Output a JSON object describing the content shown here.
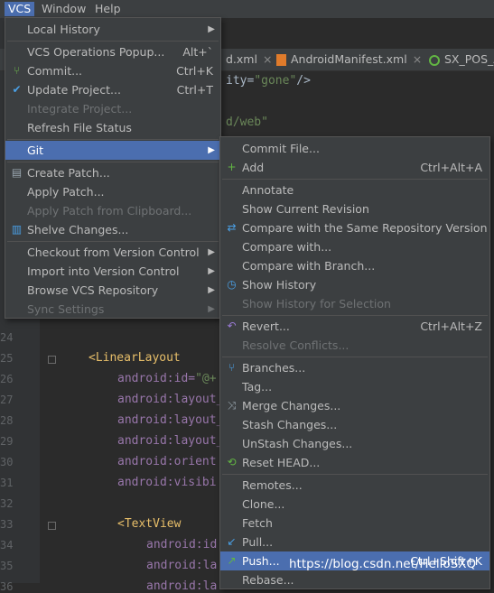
{
  "menubar": {
    "items": [
      "VCS",
      "Window",
      "Help"
    ]
  },
  "tabs": [
    {
      "label": "d.xml",
      "icon": "xml-file-icon"
    },
    {
      "label": "AndroidManifest.xml",
      "icon": "xml-file-icon"
    },
    {
      "label": "SX_POS_A",
      "icon": "android-icon"
    }
  ],
  "code": {
    "top": [
      {
        "text_pre": "ity=",
        "text_str": "\"gone\"",
        "text_post": "/>"
      },
      {
        "text_str": "d/web\""
      }
    ],
    "lines": [
      {
        "n": "24"
      },
      {
        "n": "25",
        "tag": "<LinearLayout"
      },
      {
        "n": "26",
        "attr": "android:id=",
        "str": "\"@+"
      },
      {
        "n": "27",
        "attr": "android:layout_"
      },
      {
        "n": "28",
        "attr": "android:layout_"
      },
      {
        "n": "29",
        "attr": "android:layout_"
      },
      {
        "n": "30",
        "attr": "android:orient"
      },
      {
        "n": "31",
        "attr": "android:visibi"
      },
      {
        "n": "32"
      },
      {
        "n": "33",
        "tag": "<TextView"
      },
      {
        "n": "34",
        "attr": "android:id"
      },
      {
        "n": "35",
        "attr": "android:la"
      },
      {
        "n": "36",
        "attr": "android:la"
      }
    ]
  },
  "vcs_menu": {
    "items": [
      {
        "label": "Local History",
        "submenu": true,
        "disabled": false
      },
      {
        "sep": true
      },
      {
        "label": "VCS Operations Popup...",
        "shortcut": "Alt+`",
        "disabled": false
      },
      {
        "label": "Commit...",
        "shortcut": "Ctrl+K",
        "icon": "commit-icon",
        "disabled": false
      },
      {
        "label": "Update Project...",
        "shortcut": "Ctrl+T",
        "icon": "update-icon",
        "disabled": false
      },
      {
        "label": "Integrate Project...",
        "disabled": true
      },
      {
        "label": "Refresh File Status",
        "disabled": false
      },
      {
        "sep": true
      },
      {
        "label": "Git",
        "submenu": true,
        "selected": true
      },
      {
        "sep": true
      },
      {
        "label": "Create Patch...",
        "icon": "patch-icon",
        "disabled": false
      },
      {
        "label": "Apply Patch...",
        "disabled": false
      },
      {
        "label": "Apply Patch from Clipboard...",
        "disabled": true
      },
      {
        "label": "Shelve Changes...",
        "icon": "shelve-icon",
        "disabled": false
      },
      {
        "sep": true
      },
      {
        "label": "Checkout from Version Control",
        "submenu": true,
        "disabled": false
      },
      {
        "label": "Import into Version Control",
        "submenu": true,
        "disabled": false
      },
      {
        "label": "Browse VCS Repository",
        "submenu": true,
        "disabled": false
      },
      {
        "label": "Sync Settings",
        "submenu": true,
        "disabled": true
      }
    ]
  },
  "git_menu": {
    "items": [
      {
        "label": "Commit File...",
        "disabled": false
      },
      {
        "label": "Add",
        "shortcut": "Ctrl+Alt+A",
        "icon": "plus-icon",
        "disabled": false
      },
      {
        "sep": true
      },
      {
        "label": "Annotate",
        "disabled": false
      },
      {
        "label": "Show Current Revision",
        "disabled": false
      },
      {
        "label": "Compare with the Same Repository Version",
        "icon": "compare-icon",
        "disabled": false
      },
      {
        "label": "Compare with...",
        "disabled": false
      },
      {
        "label": "Compare with Branch...",
        "disabled": false
      },
      {
        "label": "Show History",
        "icon": "history-icon",
        "disabled": false
      },
      {
        "label": "Show History for Selection",
        "disabled": true
      },
      {
        "sep": true
      },
      {
        "label": "Revert...",
        "shortcut": "Ctrl+Alt+Z",
        "icon": "revert-icon",
        "disabled": false
      },
      {
        "label": "Resolve Conflicts...",
        "disabled": true
      },
      {
        "sep": true
      },
      {
        "label": "Branches...",
        "icon": "branch-icon",
        "disabled": false
      },
      {
        "label": "Tag...",
        "disabled": false
      },
      {
        "label": "Merge Changes...",
        "icon": "merge-icon",
        "disabled": false
      },
      {
        "label": "Stash Changes...",
        "disabled": false
      },
      {
        "label": "UnStash Changes...",
        "disabled": false
      },
      {
        "label": "Reset HEAD...",
        "icon": "reset-icon",
        "disabled": false
      },
      {
        "sep": true
      },
      {
        "label": "Remotes...",
        "disabled": false
      },
      {
        "label": "Clone...",
        "disabled": false
      },
      {
        "label": "Fetch",
        "disabled": false
      },
      {
        "label": "Pull...",
        "icon": "pull-icon",
        "disabled": false
      },
      {
        "label": "Push...",
        "shortcut": "Ctrl+Shift+K",
        "icon": "push-icon",
        "selected": true
      },
      {
        "label": "Rebase...",
        "disabled": false
      }
    ]
  },
  "watermark": "https://blog.csdn.net/HelloSXQ",
  "colors": {
    "selection": "#4b6eaf",
    "menu_bg": "#3c3f41",
    "editor_bg": "#2b2b2b"
  }
}
